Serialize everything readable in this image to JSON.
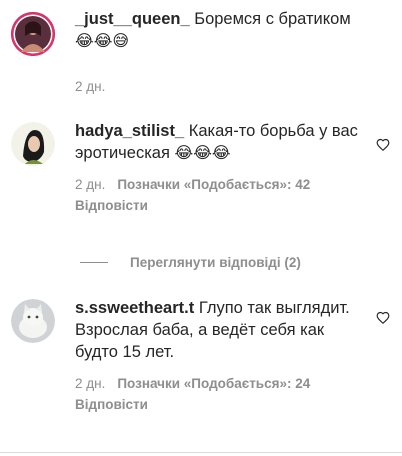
{
  "comments": [
    {
      "username": "_just__queen_",
      "text": "Боремся с братиком",
      "emoji": "😂😂😅",
      "time": "2 дн.",
      "likes": "",
      "reply": ""
    },
    {
      "username": "hadya_stilist_",
      "text": "Какая-то борьба у вас эротическая",
      "emoji": "😂😂😂",
      "time": "2 дн.",
      "likes": "Позначки «Подобається»: 42",
      "reply": "Відповісти"
    },
    {
      "username": "s.ssweetheart.t",
      "text": "Глупо так выглядит. Взрослая баба, а ведёт себя как будто 15 лет.",
      "emoji": "",
      "time": "2 дн.",
      "likes": "Позначки «Подобається»: 24",
      "reply": "Відповісти"
    }
  ],
  "view_replies": "Переглянути відповіді (2)",
  "icons": {
    "like": "heart-outline-icon"
  },
  "colors": {
    "text": "#262626",
    "muted": "#8e8e8e"
  }
}
